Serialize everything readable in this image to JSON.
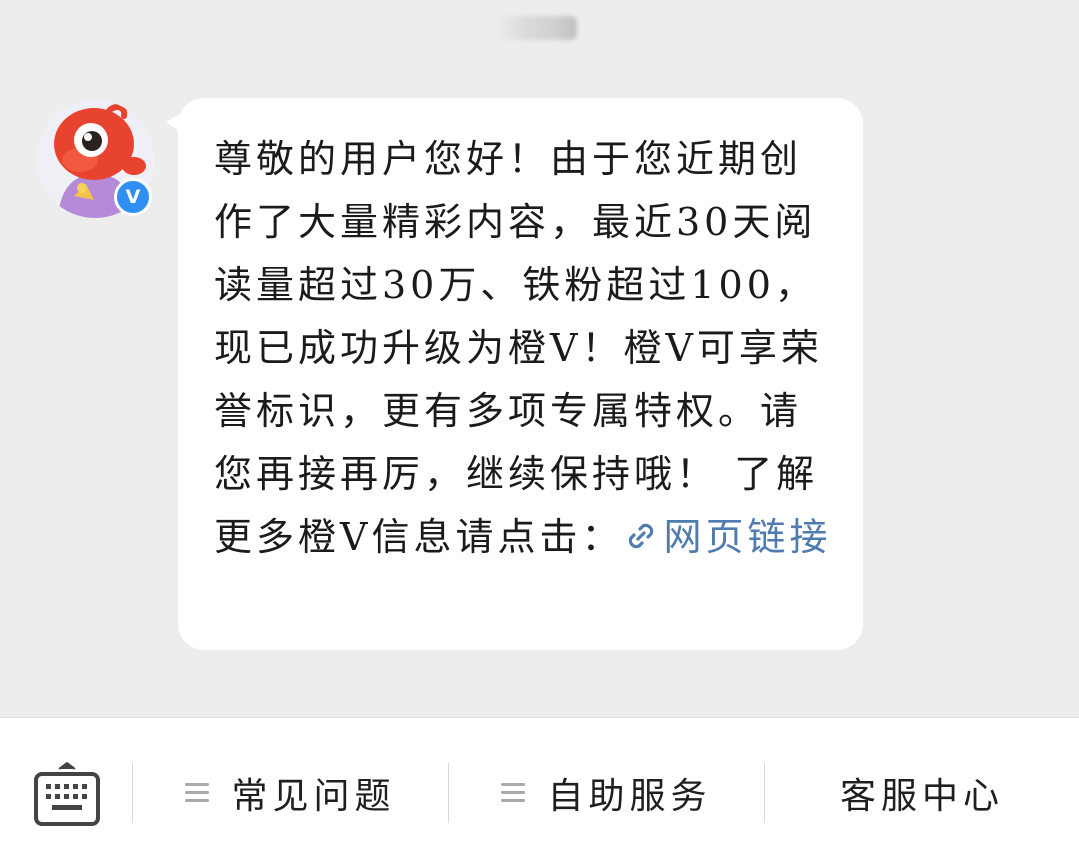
{
  "message": {
    "text": "尊敬的用户您好！由于您近期创作了大量精彩内容，最近30天阅读量超过30万、铁粉超过100，现已成功升级为橙V！橙V可享荣誉标识，更有多项专属特权。请您再接再厉，继续保持哦！ 了解更多橙V信息请点击：",
    "link_label": "网页链接",
    "link_icon": "link-icon"
  },
  "avatar": {
    "icon": "weibo-mascot-avatar",
    "badge_label": "V",
    "badge_color": "#2f8ff5"
  },
  "bottom_bar": {
    "keyboard_icon": "keyboard-icon",
    "items": [
      {
        "label": "常见问题",
        "icon": "menu-icon"
      },
      {
        "label": "自助服务",
        "icon": "menu-icon"
      },
      {
        "label": "客服中心"
      }
    ]
  },
  "colors": {
    "background": "#ededed",
    "bubble": "#ffffff",
    "link": "#4f7bb0",
    "text": "#1b1b1b"
  }
}
